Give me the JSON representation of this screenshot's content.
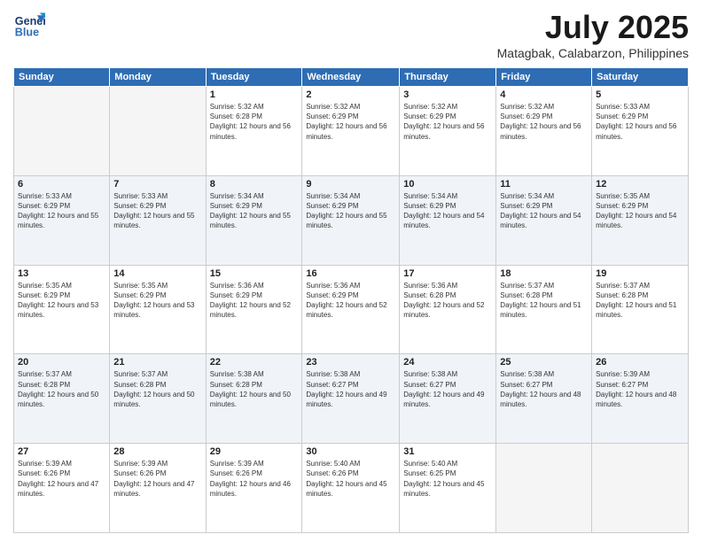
{
  "logo": {
    "line1": "General",
    "line2": "Blue"
  },
  "title": "July 2025",
  "location": "Matagbak, Calabarzon, Philippines",
  "days_of_week": [
    "Sunday",
    "Monday",
    "Tuesday",
    "Wednesday",
    "Thursday",
    "Friday",
    "Saturday"
  ],
  "weeks": [
    [
      {
        "day": "",
        "sunrise": "",
        "sunset": "",
        "daylight": "",
        "empty": true
      },
      {
        "day": "",
        "sunrise": "",
        "sunset": "",
        "daylight": "",
        "empty": true
      },
      {
        "day": "1",
        "sunrise": "Sunrise: 5:32 AM",
        "sunset": "Sunset: 6:28 PM",
        "daylight": "Daylight: 12 hours and 56 minutes."
      },
      {
        "day": "2",
        "sunrise": "Sunrise: 5:32 AM",
        "sunset": "Sunset: 6:29 PM",
        "daylight": "Daylight: 12 hours and 56 minutes."
      },
      {
        "day": "3",
        "sunrise": "Sunrise: 5:32 AM",
        "sunset": "Sunset: 6:29 PM",
        "daylight": "Daylight: 12 hours and 56 minutes."
      },
      {
        "day": "4",
        "sunrise": "Sunrise: 5:32 AM",
        "sunset": "Sunset: 6:29 PM",
        "daylight": "Daylight: 12 hours and 56 minutes."
      },
      {
        "day": "5",
        "sunrise": "Sunrise: 5:33 AM",
        "sunset": "Sunset: 6:29 PM",
        "daylight": "Daylight: 12 hours and 56 minutes."
      }
    ],
    [
      {
        "day": "6",
        "sunrise": "Sunrise: 5:33 AM",
        "sunset": "Sunset: 6:29 PM",
        "daylight": "Daylight: 12 hours and 55 minutes."
      },
      {
        "day": "7",
        "sunrise": "Sunrise: 5:33 AM",
        "sunset": "Sunset: 6:29 PM",
        "daylight": "Daylight: 12 hours and 55 minutes."
      },
      {
        "day": "8",
        "sunrise": "Sunrise: 5:34 AM",
        "sunset": "Sunset: 6:29 PM",
        "daylight": "Daylight: 12 hours and 55 minutes."
      },
      {
        "day": "9",
        "sunrise": "Sunrise: 5:34 AM",
        "sunset": "Sunset: 6:29 PM",
        "daylight": "Daylight: 12 hours and 55 minutes."
      },
      {
        "day": "10",
        "sunrise": "Sunrise: 5:34 AM",
        "sunset": "Sunset: 6:29 PM",
        "daylight": "Daylight: 12 hours and 54 minutes."
      },
      {
        "day": "11",
        "sunrise": "Sunrise: 5:34 AM",
        "sunset": "Sunset: 6:29 PM",
        "daylight": "Daylight: 12 hours and 54 minutes."
      },
      {
        "day": "12",
        "sunrise": "Sunrise: 5:35 AM",
        "sunset": "Sunset: 6:29 PM",
        "daylight": "Daylight: 12 hours and 54 minutes."
      }
    ],
    [
      {
        "day": "13",
        "sunrise": "Sunrise: 5:35 AM",
        "sunset": "Sunset: 6:29 PM",
        "daylight": "Daylight: 12 hours and 53 minutes."
      },
      {
        "day": "14",
        "sunrise": "Sunrise: 5:35 AM",
        "sunset": "Sunset: 6:29 PM",
        "daylight": "Daylight: 12 hours and 53 minutes."
      },
      {
        "day": "15",
        "sunrise": "Sunrise: 5:36 AM",
        "sunset": "Sunset: 6:29 PM",
        "daylight": "Daylight: 12 hours and 52 minutes."
      },
      {
        "day": "16",
        "sunrise": "Sunrise: 5:36 AM",
        "sunset": "Sunset: 6:29 PM",
        "daylight": "Daylight: 12 hours and 52 minutes."
      },
      {
        "day": "17",
        "sunrise": "Sunrise: 5:36 AM",
        "sunset": "Sunset: 6:28 PM",
        "daylight": "Daylight: 12 hours and 52 minutes."
      },
      {
        "day": "18",
        "sunrise": "Sunrise: 5:37 AM",
        "sunset": "Sunset: 6:28 PM",
        "daylight": "Daylight: 12 hours and 51 minutes."
      },
      {
        "day": "19",
        "sunrise": "Sunrise: 5:37 AM",
        "sunset": "Sunset: 6:28 PM",
        "daylight": "Daylight: 12 hours and 51 minutes."
      }
    ],
    [
      {
        "day": "20",
        "sunrise": "Sunrise: 5:37 AM",
        "sunset": "Sunset: 6:28 PM",
        "daylight": "Daylight: 12 hours and 50 minutes."
      },
      {
        "day": "21",
        "sunrise": "Sunrise: 5:37 AM",
        "sunset": "Sunset: 6:28 PM",
        "daylight": "Daylight: 12 hours and 50 minutes."
      },
      {
        "day": "22",
        "sunrise": "Sunrise: 5:38 AM",
        "sunset": "Sunset: 6:28 PM",
        "daylight": "Daylight: 12 hours and 50 minutes."
      },
      {
        "day": "23",
        "sunrise": "Sunrise: 5:38 AM",
        "sunset": "Sunset: 6:27 PM",
        "daylight": "Daylight: 12 hours and 49 minutes."
      },
      {
        "day": "24",
        "sunrise": "Sunrise: 5:38 AM",
        "sunset": "Sunset: 6:27 PM",
        "daylight": "Daylight: 12 hours and 49 minutes."
      },
      {
        "day": "25",
        "sunrise": "Sunrise: 5:38 AM",
        "sunset": "Sunset: 6:27 PM",
        "daylight": "Daylight: 12 hours and 48 minutes."
      },
      {
        "day": "26",
        "sunrise": "Sunrise: 5:39 AM",
        "sunset": "Sunset: 6:27 PM",
        "daylight": "Daylight: 12 hours and 48 minutes."
      }
    ],
    [
      {
        "day": "27",
        "sunrise": "Sunrise: 5:39 AM",
        "sunset": "Sunset: 6:26 PM",
        "daylight": "Daylight: 12 hours and 47 minutes."
      },
      {
        "day": "28",
        "sunrise": "Sunrise: 5:39 AM",
        "sunset": "Sunset: 6:26 PM",
        "daylight": "Daylight: 12 hours and 47 minutes."
      },
      {
        "day": "29",
        "sunrise": "Sunrise: 5:39 AM",
        "sunset": "Sunset: 6:26 PM",
        "daylight": "Daylight: 12 hours and 46 minutes."
      },
      {
        "day": "30",
        "sunrise": "Sunrise: 5:40 AM",
        "sunset": "Sunset: 6:26 PM",
        "daylight": "Daylight: 12 hours and 45 minutes."
      },
      {
        "day": "31",
        "sunrise": "Sunrise: 5:40 AM",
        "sunset": "Sunset: 6:25 PM",
        "daylight": "Daylight: 12 hours and 45 minutes."
      },
      {
        "day": "",
        "sunrise": "",
        "sunset": "",
        "daylight": "",
        "empty": true
      },
      {
        "day": "",
        "sunrise": "",
        "sunset": "",
        "daylight": "",
        "empty": true
      }
    ]
  ]
}
